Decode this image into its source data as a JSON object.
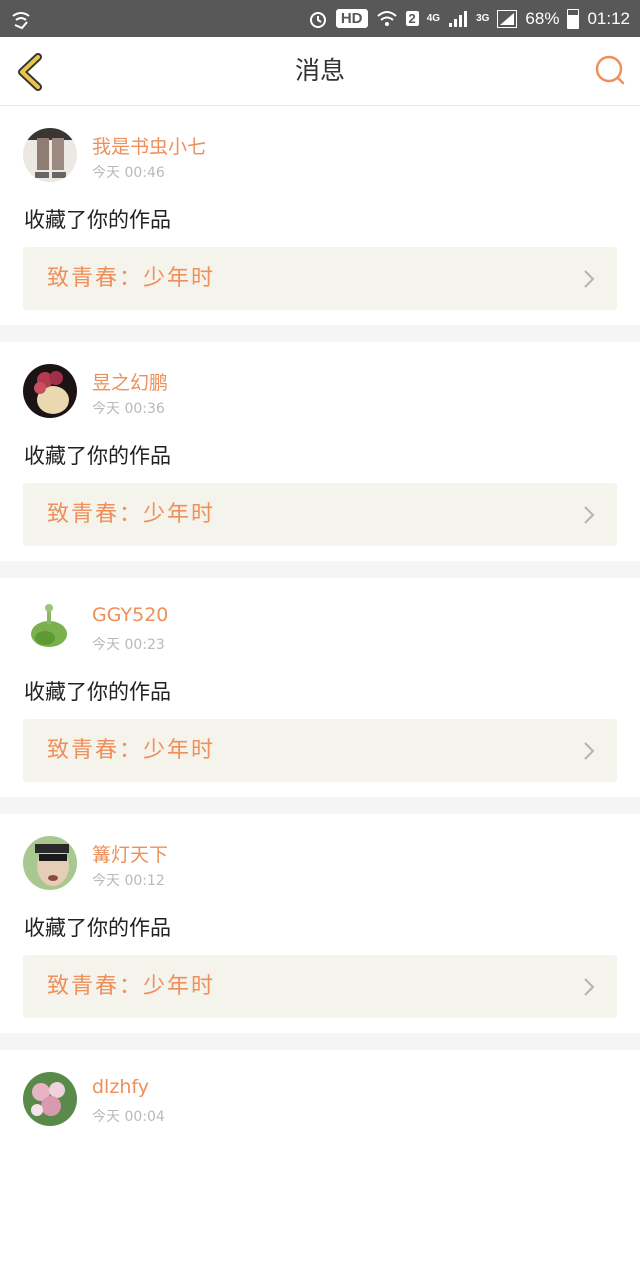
{
  "status_bar": {
    "hd": "HD",
    "sim_badge": "2",
    "net1": "4G",
    "net2": "3G",
    "battery": "68%",
    "time": "01:12"
  },
  "header": {
    "title": "消息"
  },
  "messages": [
    {
      "user": "我是书虫小七",
      "time": "今天 00:46",
      "action": "收藏了你的作品",
      "work": "致青春：少年时"
    },
    {
      "user": "昱之幻鹏",
      "time": "今天 00:36",
      "action": "收藏了你的作品",
      "work": "致青春：少年时"
    },
    {
      "user": "GGY520",
      "time": "今天 00:23",
      "action": "收藏了你的作品",
      "work": "致青春：少年时"
    },
    {
      "user": "篝灯天下",
      "time": "今天 00:12",
      "action": "收藏了你的作品",
      "work": "致青春：少年时"
    },
    {
      "user": "dlzhfy",
      "time": "今天 00:04"
    }
  ],
  "colors": {
    "accent": "#ef8f5a",
    "back_icon": "#e9c64a",
    "card_bg": "#f4f3ec"
  }
}
